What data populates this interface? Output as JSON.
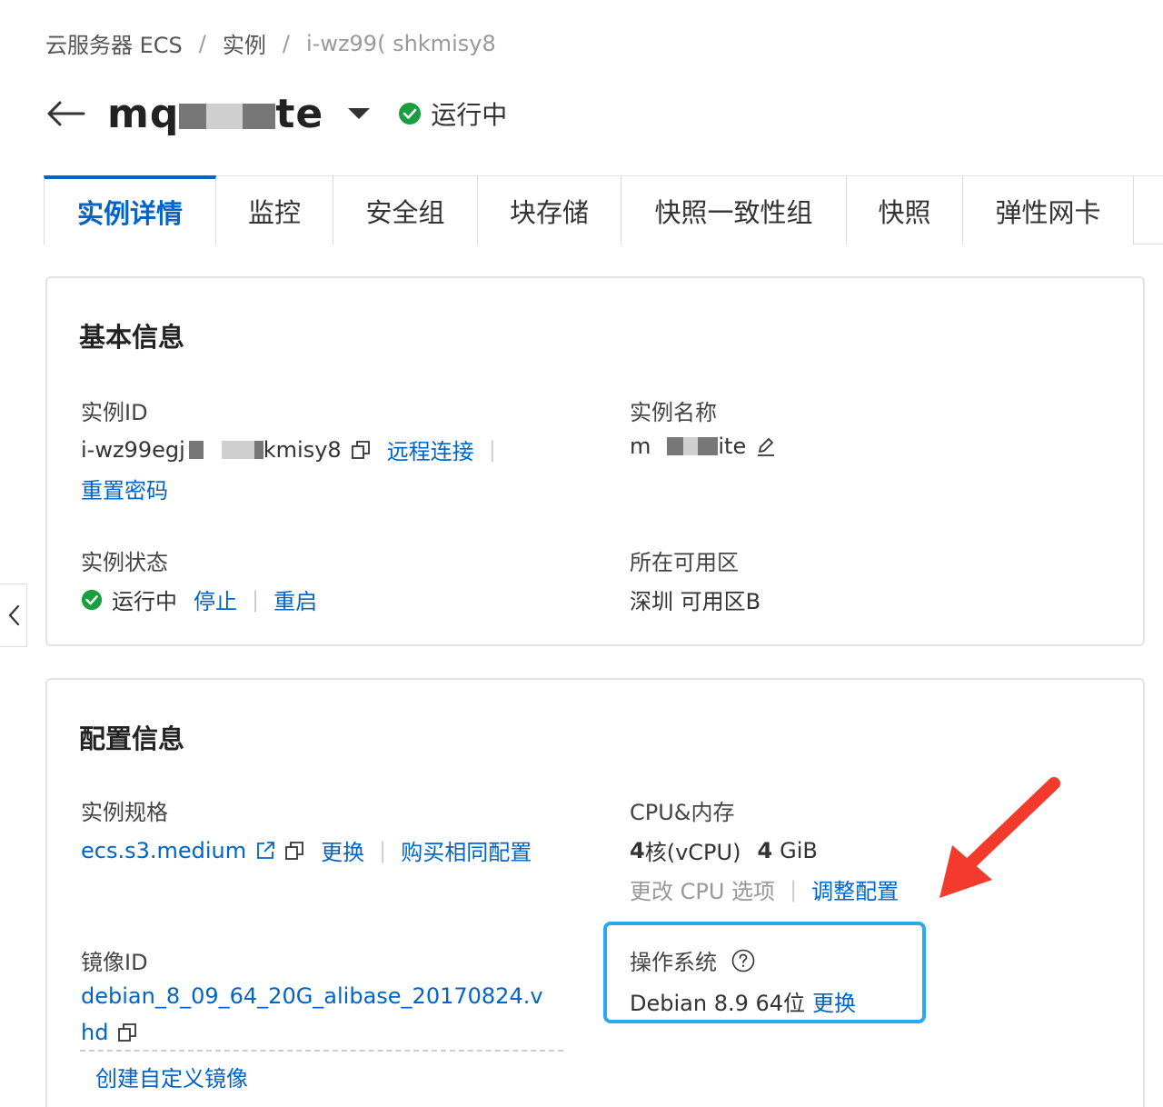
{
  "breadcrumb": {
    "items": [
      "云服务器 ECS",
      "实例",
      "i-wz99(    shkmisy8"
    ],
    "separator": "/"
  },
  "header": {
    "title_start": "mq",
    "title_end": "te",
    "status": "运行中"
  },
  "tabs": [
    "实例详情",
    "监控",
    "安全组",
    "块存储",
    "快照一致性组",
    "快照",
    "弹性网卡"
  ],
  "basic_info": {
    "title": "基本信息",
    "instance_id_label": "实例ID",
    "instance_id_start": "i-wz99egj",
    "instance_id_end": "kmisy8",
    "remote_connect": "远程连接",
    "reset_password": "重置密码",
    "instance_name_label": "实例名称",
    "instance_name_start": "m",
    "instance_name_end": "ite",
    "status_label": "实例状态",
    "status_value": "运行中",
    "stop": "停止",
    "restart": "重启",
    "zone_label": "所在可用区",
    "zone_value": "深圳 可用区B"
  },
  "config_info": {
    "title": "配置信息",
    "spec_label": "实例规格",
    "spec_value": "ecs.s3.medium",
    "change": "更换",
    "buy_same": "购买相同配置",
    "cpu_mem_label": "CPU&内存",
    "cpu_cores": "4",
    "cpu_unit": "核(vCPU)",
    "mem_value": "4",
    "mem_unit": "GiB",
    "change_cpu_options": "更改 CPU 选项",
    "adjust_config": "调整配置",
    "image_id_label": "镜像ID",
    "image_id_line1": "debian_8_09_64_20G_alibase_20170824.v",
    "image_id_line2": "hd",
    "create_custom_image": "创建自定义镜像",
    "os_label": "操作系统",
    "os_value": "Debian 8.9 64位",
    "os_change": "更换"
  },
  "colors": {
    "link": "#0064c8",
    "success": "#1a9e3f",
    "highlight": "#2aa9f0",
    "arrow": "#f23b2c"
  }
}
